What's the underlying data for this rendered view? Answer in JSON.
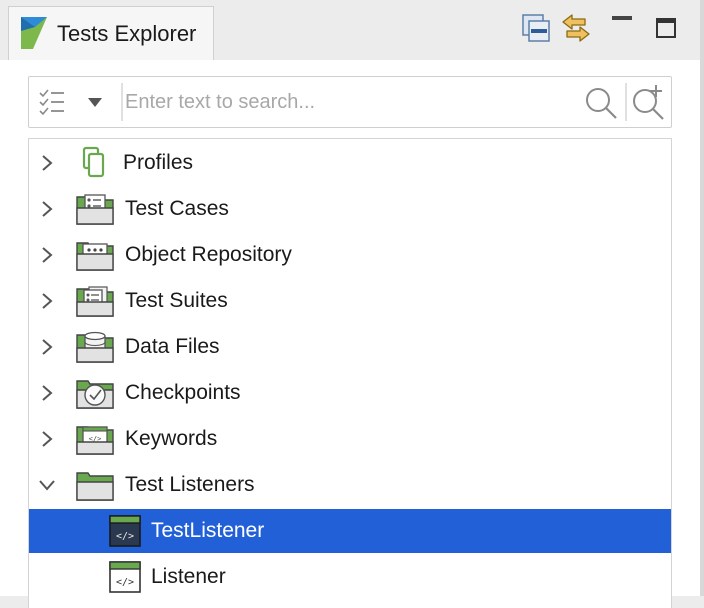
{
  "app": {
    "tab_title": "Tests Explorer",
    "icons": {
      "app": "katalon-logo-icon",
      "collapse": "collapse-all-icon",
      "link": "link-with-editor-icon",
      "minimize": "minimize-icon",
      "maximize": "maximize-icon"
    }
  },
  "search": {
    "placeholder": "Enter text to search...",
    "value": "",
    "icons": {
      "filter": "filter-list-icon",
      "dropdown": "dropdown-arrow-icon",
      "search": "search-icon",
      "advanced": "advanced-search-icon"
    }
  },
  "tree": {
    "items": [
      {
        "label": "Profiles",
        "icon": "profiles-icon",
        "expanded": false,
        "level": 0
      },
      {
        "label": "Test Cases",
        "icon": "test-cases-folder-icon",
        "expanded": false,
        "level": 0
      },
      {
        "label": "Object Repository",
        "icon": "object-repository-folder-icon",
        "expanded": false,
        "level": 0
      },
      {
        "label": "Test Suites",
        "icon": "test-suites-folder-icon",
        "expanded": false,
        "level": 0
      },
      {
        "label": "Data Files",
        "icon": "data-files-folder-icon",
        "expanded": false,
        "level": 0
      },
      {
        "label": "Checkpoints",
        "icon": "checkpoints-folder-icon",
        "expanded": false,
        "level": 0
      },
      {
        "label": "Keywords",
        "icon": "keywords-folder-icon",
        "expanded": false,
        "level": 0
      },
      {
        "label": "Test Listeners",
        "icon": "test-listeners-folder-icon",
        "expanded": true,
        "level": 0
      },
      {
        "label": "TestListener",
        "icon": "listener-script-icon",
        "level": 1,
        "selected": true
      },
      {
        "label": "Listener",
        "icon": "listener-script-icon",
        "level": 1,
        "selected": false
      }
    ]
  },
  "colors": {
    "selection": "#2260d8",
    "accent_green": "#6aa84f",
    "folder_gray": "#e2e2e2"
  }
}
